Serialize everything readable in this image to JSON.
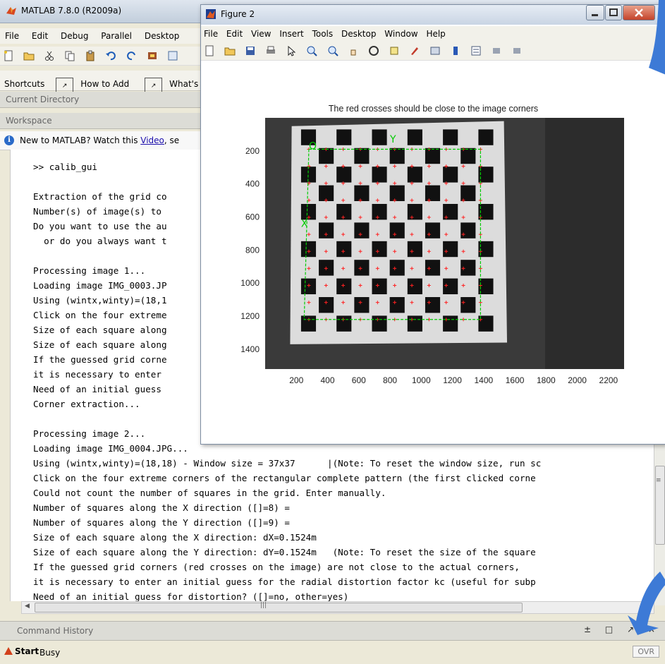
{
  "matlab": {
    "title": "MATLAB 7.8.0 (R2009a)",
    "menu": [
      "File",
      "Edit",
      "Debug",
      "Parallel",
      "Desktop"
    ],
    "shortcuts": {
      "label": "Shortcuts",
      "how_to_add": "How to Add",
      "whats_new": "What's N"
    },
    "panels": {
      "current_directory": "Current Directory",
      "workspace": "Workspace"
    },
    "info": {
      "before_link": "New to MATLAB? Watch this ",
      "link": "Video",
      "after_link": ", se"
    },
    "command_window_lines": [
      ">> calib_gui",
      "",
      "Extraction of the grid co",
      "Number(s) of image(s) to ",
      "Do you want to use the au",
      "  or do you always want t",
      "",
      "Processing image 1...",
      "Loading image IMG_0003.JP",
      "Using (wintx,winty)=(18,1",
      "Click on the four extreme",
      "Size of each square along",
      "Size of each square along",
      "If the guessed grid corne",
      "it is necessary to enter ",
      "Need of an initial guess ",
      "Corner extraction...",
      "",
      "Processing image 2...",
      "Loading image IMG_0004.JPG...",
      "Using (wintx,winty)=(18,18) - Window size = 37x37      |(Note: To reset the window size, run sc",
      "Click on the four extreme corners of the rectangular complete pattern (the first clicked corne",
      "Could not count the number of squares in the grid. Enter manually.",
      "Number of squares along the X direction ([]=8) =",
      "Number of squares along the Y direction ([]=9) =",
      "Size of each square along the X direction: dX=0.1524m",
      "Size of each square along the Y direction: dY=0.1524m   (Note: To reset the size of the square",
      "If the guessed grid corners (red crosses on the image) are not close to the actual corners,",
      "it is necessary to enter an initial guess for the radial distortion factor kc (useful for subp",
      "Need of an initial guess for distortion? ([]=no, other=yes)"
    ],
    "command_history": "Command History",
    "status": {
      "start": "Start",
      "busy": "Busy",
      "ovr": "OVR"
    }
  },
  "figure": {
    "title": "Figure 2",
    "menu": [
      "File",
      "Edit",
      "View",
      "Insert",
      "Tools",
      "Desktop",
      "Window",
      "Help"
    ],
    "plot_title": "The red crosses should be close to the image corners",
    "y_ticks": [
      "200",
      "400",
      "600",
      "800",
      "1000",
      "1200",
      "1400"
    ],
    "x_ticks": [
      "200",
      "400",
      "600",
      "800",
      "1000",
      "1200",
      "1400",
      "1600",
      "1800",
      "2000",
      "2200"
    ],
    "corner_labels": {
      "origin": "O",
      "x_axis": "X",
      "y_axis": "Y"
    }
  },
  "chart_data": {
    "type": "other",
    "title": "The red crosses should be close to the image corners",
    "x_ticks": [
      200,
      400,
      600,
      800,
      1000,
      1200,
      1400,
      1600,
      1800,
      2000,
      2200
    ],
    "y_ticks": [
      200,
      400,
      600,
      800,
      1000,
      1200,
      1400
    ],
    "xlim": [
      0,
      2300
    ],
    "ylim": [
      0,
      1520
    ],
    "grid_squares": {
      "x": 8,
      "y": 9
    },
    "axis_colors": {
      "grid": "#00cc00",
      "corner": "#ff2020"
    }
  },
  "colors": {
    "accent_blue": "#2a6ac8",
    "overlay_arrow": "#3d7ad6"
  }
}
